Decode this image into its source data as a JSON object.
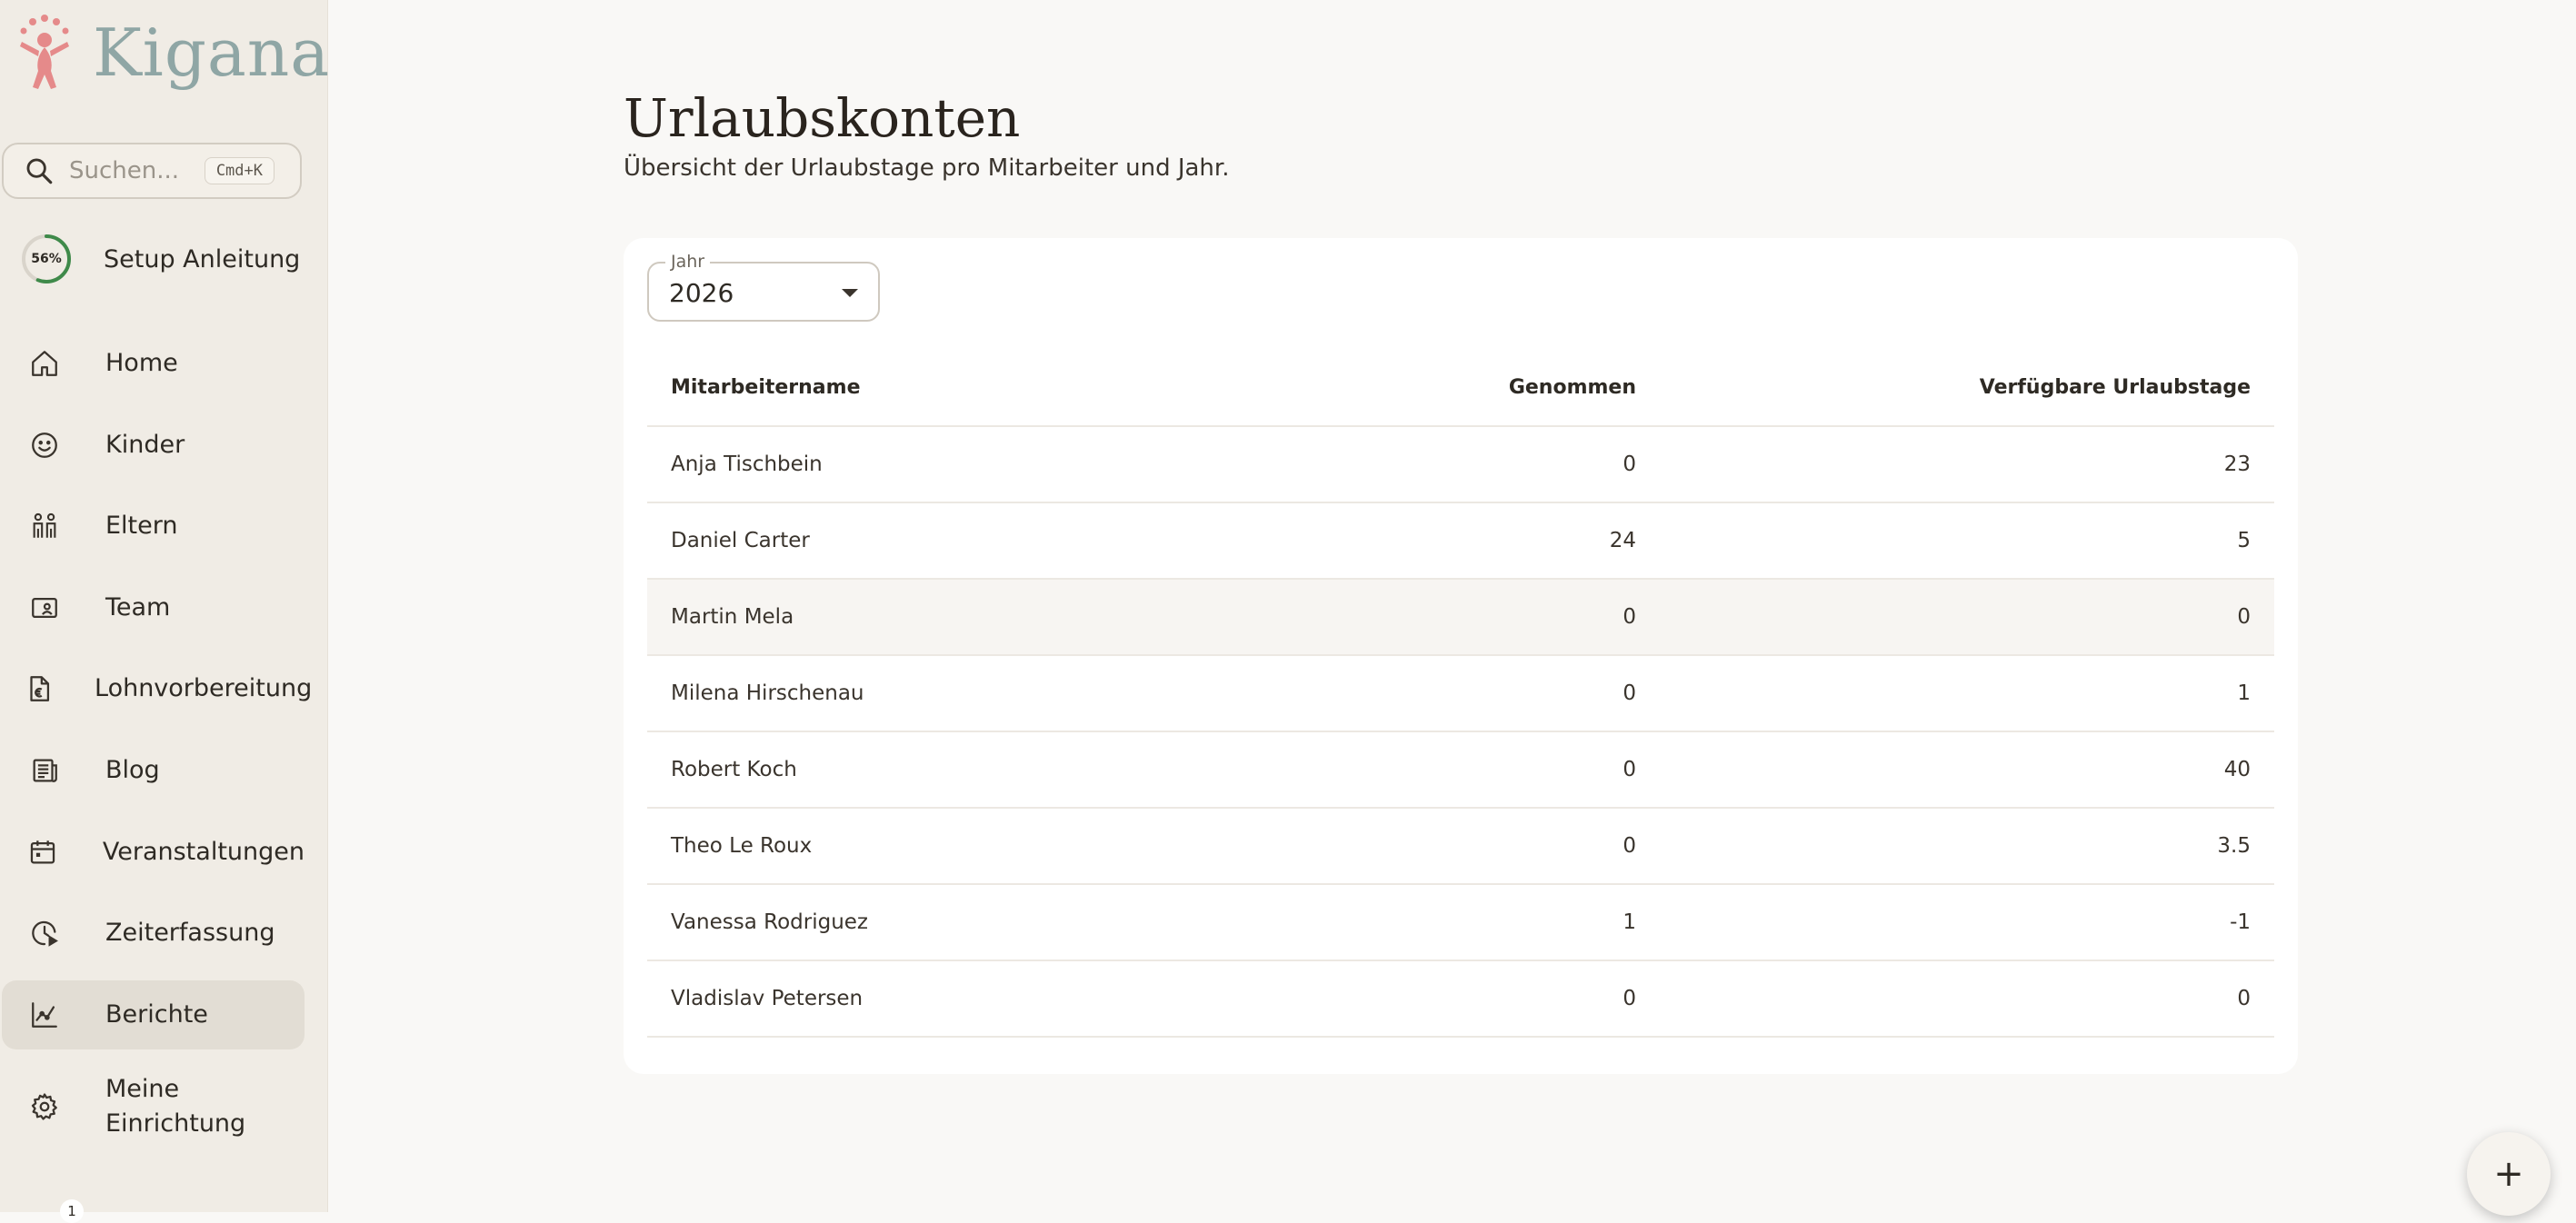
{
  "app": {
    "name": "Kigana"
  },
  "search": {
    "placeholder": "Suchen...",
    "shortcut": "Cmd+K"
  },
  "setup": {
    "progress_label": "56%",
    "progress": 0.56,
    "label": "Setup Anleitung"
  },
  "nav": [
    {
      "label": "Home",
      "icon": "home-icon"
    },
    {
      "label": "Kinder",
      "icon": "smiley-icon"
    },
    {
      "label": "Eltern",
      "icon": "parents-icon"
    },
    {
      "label": "Team",
      "icon": "id-card-icon"
    },
    {
      "label": "Lohnvorbereitung",
      "icon": "euro-document-icon"
    },
    {
      "label": "Blog",
      "icon": "newspaper-icon"
    },
    {
      "label": "Veranstaltungen",
      "icon": "calendar-icon"
    },
    {
      "label": "Zeiterfassung",
      "icon": "clock-icon"
    },
    {
      "label": "Berichte",
      "icon": "chart-icon",
      "active": true
    },
    {
      "label": "Meine Einrichtung",
      "icon": "gear-icon"
    }
  ],
  "notification_badge": "1",
  "page": {
    "title": "Urlaubskonten",
    "subtitle": "Übersicht der Urlaubstage pro Mitarbeiter und Jahr."
  },
  "year_select": {
    "label": "Jahr",
    "value": "2026"
  },
  "table": {
    "headers": [
      "Mitarbeitername",
      "Genommen",
      "Verfügbare Urlaubstage"
    ],
    "rows": [
      [
        "Anja Tischbein",
        "0",
        "23"
      ],
      [
        "Daniel Carter",
        "24",
        "5"
      ],
      [
        "Martin Mela",
        "0",
        "0"
      ],
      [
        "Milena Hirschenau",
        "0",
        "1"
      ],
      [
        "Robert Koch",
        "0",
        "40"
      ],
      [
        "Theo Le Roux",
        "0",
        "3.5"
      ],
      [
        "Vanessa Rodriguez",
        "1",
        "-1"
      ],
      [
        "Vladislav Petersen",
        "0",
        "0"
      ]
    ]
  },
  "fab": {
    "label": "+"
  },
  "colors": {
    "accent_logo": "#e58a8a",
    "logo_text": "#8fa6a5",
    "progress": "#3f8a4a",
    "sidebar_bg": "#f0ece5",
    "active_nav_bg": "#e2ddd4"
  }
}
